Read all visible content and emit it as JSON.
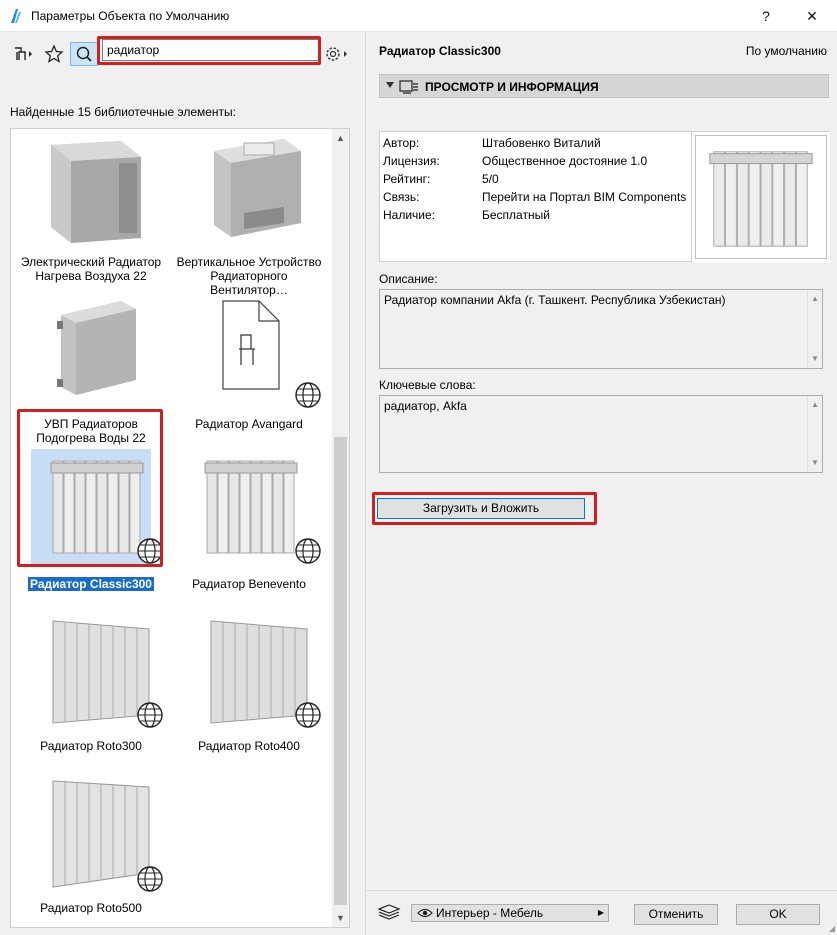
{
  "window": {
    "title": "Параметры Объекта по Умолчанию",
    "help_label": "?",
    "close_label": "✕"
  },
  "search": {
    "value": "радиатор"
  },
  "results": {
    "found_text": "Найденные 15 библиотечные элементы:",
    "items": [
      {
        "label": "Электрический Радиатор Нагрева Воздуха 22"
      },
      {
        "label": "Вертикальное Устройство Радиаторного Вентилятор…"
      },
      {
        "label": "УВП Радиаторов Подогрева Воды 22"
      },
      {
        "label": "Радиатор Avangard"
      },
      {
        "label": "Радиатор Classic300"
      },
      {
        "label": "Радиатор Benevento"
      },
      {
        "label": "Радиатор Roto300"
      },
      {
        "label": "Радиатор Roto400"
      },
      {
        "label": "Радиатор Roto500"
      }
    ]
  },
  "detail": {
    "name": "Радиатор Classic300",
    "default_label": "По умолчанию",
    "section_title": "ПРОСМОТР И ИНФОРМАЦИЯ",
    "info": [
      {
        "key": "Автор:",
        "value": "Штабовенко Виталий"
      },
      {
        "key": "Лицензия:",
        "value": "Общественное достояние 1.0"
      },
      {
        "key": "Рейтинг:",
        "value": "5/0"
      },
      {
        "key": "Связь:",
        "value": "Перейти на Портал BIM Components"
      },
      {
        "key": "Наличие:",
        "value": "Бесплатный"
      }
    ],
    "description_label": "Описание:",
    "description": "Радиатор компании Akfa (г. Ташкент. Республика Узбекистан)",
    "keywords_label": "Ключевые слова:",
    "keywords": "радиатор, Akfa",
    "load_button": "Загрузить и Вложить"
  },
  "footer": {
    "layer": "Интерьер - Мебель",
    "cancel": "Отменить",
    "ok": "OK"
  },
  "colors": {
    "selection": "#1a6ccc",
    "highlight": "#d21f1f",
    "accent": "#0078d7"
  }
}
